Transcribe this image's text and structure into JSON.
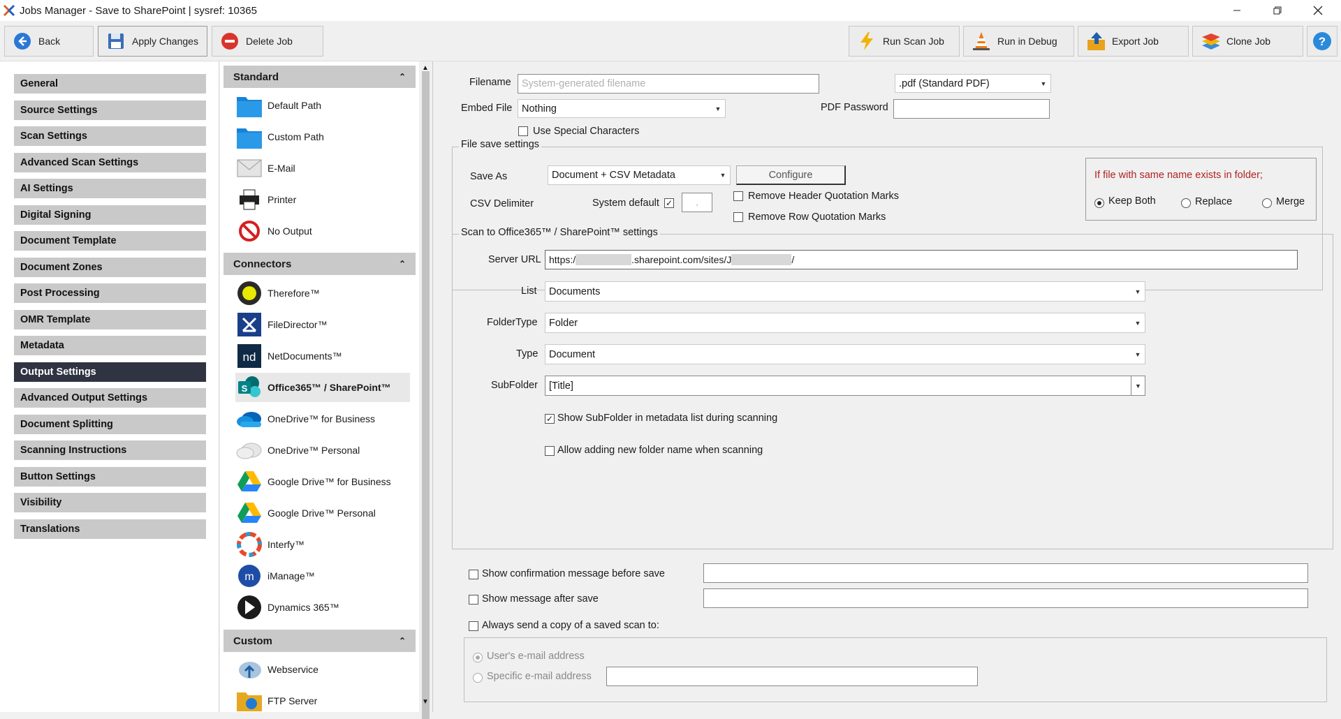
{
  "window": {
    "title": "Jobs Manager - Save to SharePoint  |  sysref: 10365"
  },
  "toolbar": {
    "back": "Back",
    "apply": "Apply Changes",
    "delete": "Delete Job",
    "run_scan": "Run Scan Job",
    "run_debug": "Run in Debug",
    "export": "Export Job",
    "clone": "Clone Job",
    "help": "?"
  },
  "nav": {
    "items": [
      "General",
      "Source Settings",
      "Scan Settings",
      "Advanced Scan Settings",
      "AI Settings",
      "Digital Signing",
      "Document Template",
      "Document Zones",
      "Post Processing",
      "OMR Template",
      "Metadata",
      "Output Settings",
      "Advanced Output Settings",
      "Document Splitting",
      "Scanning Instructions",
      "Button Settings",
      "Visibility",
      "Translations"
    ],
    "active": "Output Settings"
  },
  "outputs": {
    "standard_header": "Standard",
    "standard": [
      {
        "label": "Default Path",
        "icon": "folder-icon"
      },
      {
        "label": "Custom Path",
        "icon": "folder-icon"
      },
      {
        "label": "E-Mail",
        "icon": "envelope-icon"
      },
      {
        "label": "Printer",
        "icon": "printer-icon"
      },
      {
        "label": "No Output",
        "icon": "no-entry-icon"
      }
    ],
    "connectors_header": "Connectors",
    "connectors": [
      {
        "label": "Therefore™",
        "icon": "therefore-icon"
      },
      {
        "label": "FileDirector™",
        "icon": "filedirector-icon"
      },
      {
        "label": "NetDocuments™",
        "icon": "netdocuments-icon"
      },
      {
        "label": "Office365™ / SharePoint™",
        "icon": "sharepoint-icon"
      },
      {
        "label": "OneDrive™ for Business",
        "icon": "onedrive-business-icon"
      },
      {
        "label": "OneDrive™ Personal",
        "icon": "onedrive-personal-icon"
      },
      {
        "label": "Google Drive™ for Business",
        "icon": "google-drive-icon"
      },
      {
        "label": "Google Drive™ Personal",
        "icon": "google-drive-icon"
      },
      {
        "label": "Interfy™",
        "icon": "interfy-icon"
      },
      {
        "label": "iManage™",
        "icon": "imanage-icon"
      },
      {
        "label": "Dynamics 365™",
        "icon": "dynamics-icon"
      }
    ],
    "custom_header": "Custom",
    "custom": [
      {
        "label": "Webservice",
        "icon": "cloud-upload-icon"
      },
      {
        "label": "FTP Server",
        "icon": "ftp-folder-icon"
      }
    ]
  },
  "form": {
    "filename_label": "Filename",
    "filename_placeholder": "System-generated filename",
    "format_value": ".pdf (Standard PDF)",
    "embed_label": "Embed File",
    "embed_value": "Nothing",
    "pdf_password_label": "PDF Password",
    "pdf_password_value": "",
    "special_chars_label": "Use Special Characters",
    "special_chars_checked": false,
    "file_save_title": "File save settings",
    "save_as_label": "Save As",
    "save_as_value": "Document + CSV Metadata",
    "configure_label": "Configure",
    "csv_delim_label": "CSV Delimiter",
    "system_default_label": "System default",
    "system_default_checked": true,
    "delimiter_value": ",",
    "remove_header_quotes": "Remove Header Quotation Marks",
    "remove_row_quotes": "Remove Row Quotation Marks",
    "exists_title": "If file with same name exists in folder;",
    "keep_both": "Keep Both",
    "replace": "Replace",
    "merge": "Merge",
    "exists_selected": "Keep Both",
    "sp_title": "Scan to Office365™ / SharePoint™ settings",
    "server_url_label": "Server URL",
    "server_url_parts": [
      "https:/",
      ".sharepoint.com/sites/J",
      "/"
    ],
    "list_label": "List",
    "list_value": "Documents",
    "foldertype_label": "FolderType",
    "foldertype_value": "Folder",
    "type_label": "Type",
    "type_value": "Document",
    "subfolder_label": "SubFolder",
    "subfolder_value": "[Title]",
    "show_subfolder_label": "Show SubFolder in metadata list during scanning",
    "show_subfolder_checked": true,
    "allow_new_folder_label": "Allow adding new folder name when scanning",
    "allow_new_folder_checked": false,
    "confirm_before_label": "Show confirmation message before save",
    "msg_after_label": "Show message after save",
    "send_copy_label": "Always send a copy of a saved scan to:",
    "user_email_label": "User's e-mail address",
    "specific_email_label": "Specific e-mail address"
  },
  "colors": {
    "nav_active": "#2f3342",
    "nav_item": "#c9c9c9",
    "warning_text": "#b22222"
  }
}
